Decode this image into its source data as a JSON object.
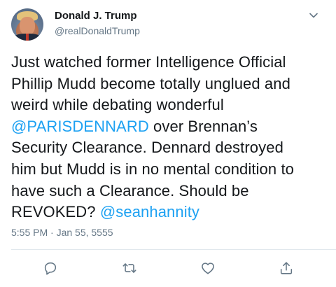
{
  "tweet": {
    "author": {
      "name": "Donald J. Trump",
      "handle": "@realDonaldTrump"
    },
    "lines": [
      [
        {
          "text": "Just watched former Intelligence Official",
          "type": "text"
        }
      ],
      [
        {
          "text": "Phillip Mudd become totally unglued and",
          "type": "text"
        }
      ],
      [
        {
          "text": "weird while debating wonderful",
          "type": "text"
        }
      ],
      [
        {
          "text": "@PARISDENNARD",
          "type": "mention"
        },
        {
          "text": " over Brennan’s",
          "type": "text"
        }
      ],
      [
        {
          "text": "Security Clearance. Dennard destroyed",
          "type": "text"
        }
      ],
      [
        {
          "text": "him but Mudd is in no mental condition to",
          "type": "text"
        }
      ],
      [
        {
          "text": "have such a Clearance. Should be",
          "type": "text"
        }
      ],
      [
        {
          "text": "REVOKED? ",
          "type": "text"
        },
        {
          "text": "@seanhannity",
          "type": "mention"
        }
      ]
    ],
    "timestamp": "5:55 PM · Jan 55, 5555",
    "icons": {
      "menu": "chevron-down-icon",
      "reply": "reply-icon",
      "retweet": "retweet-icon",
      "like": "heart-icon",
      "share": "share-icon"
    },
    "colors": {
      "link": "#1da1f2",
      "secondary_text": "#657786",
      "primary_text": "#14171a",
      "icon": "#657786"
    }
  }
}
